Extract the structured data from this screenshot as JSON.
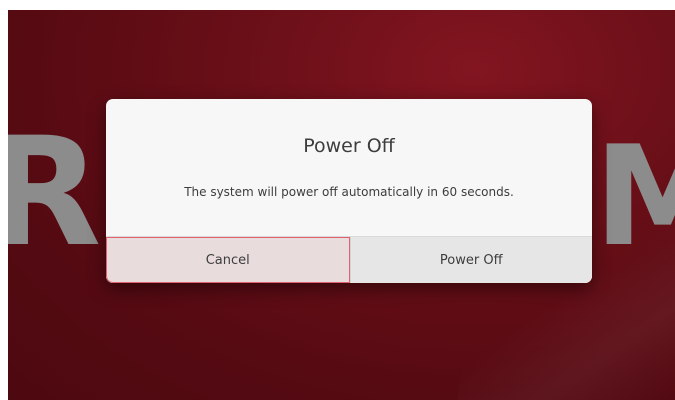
{
  "background": {
    "logo_left_letter": "R",
    "logo_right_letter": "M",
    "accent_color": "#6a0f18"
  },
  "dialog": {
    "title": "Power Off",
    "message": "The system will power off automatically in 60 seconds.",
    "buttons": {
      "cancel_label": "Cancel",
      "power_off_label": "Power Off"
    },
    "focus_color": "#e0626e"
  }
}
